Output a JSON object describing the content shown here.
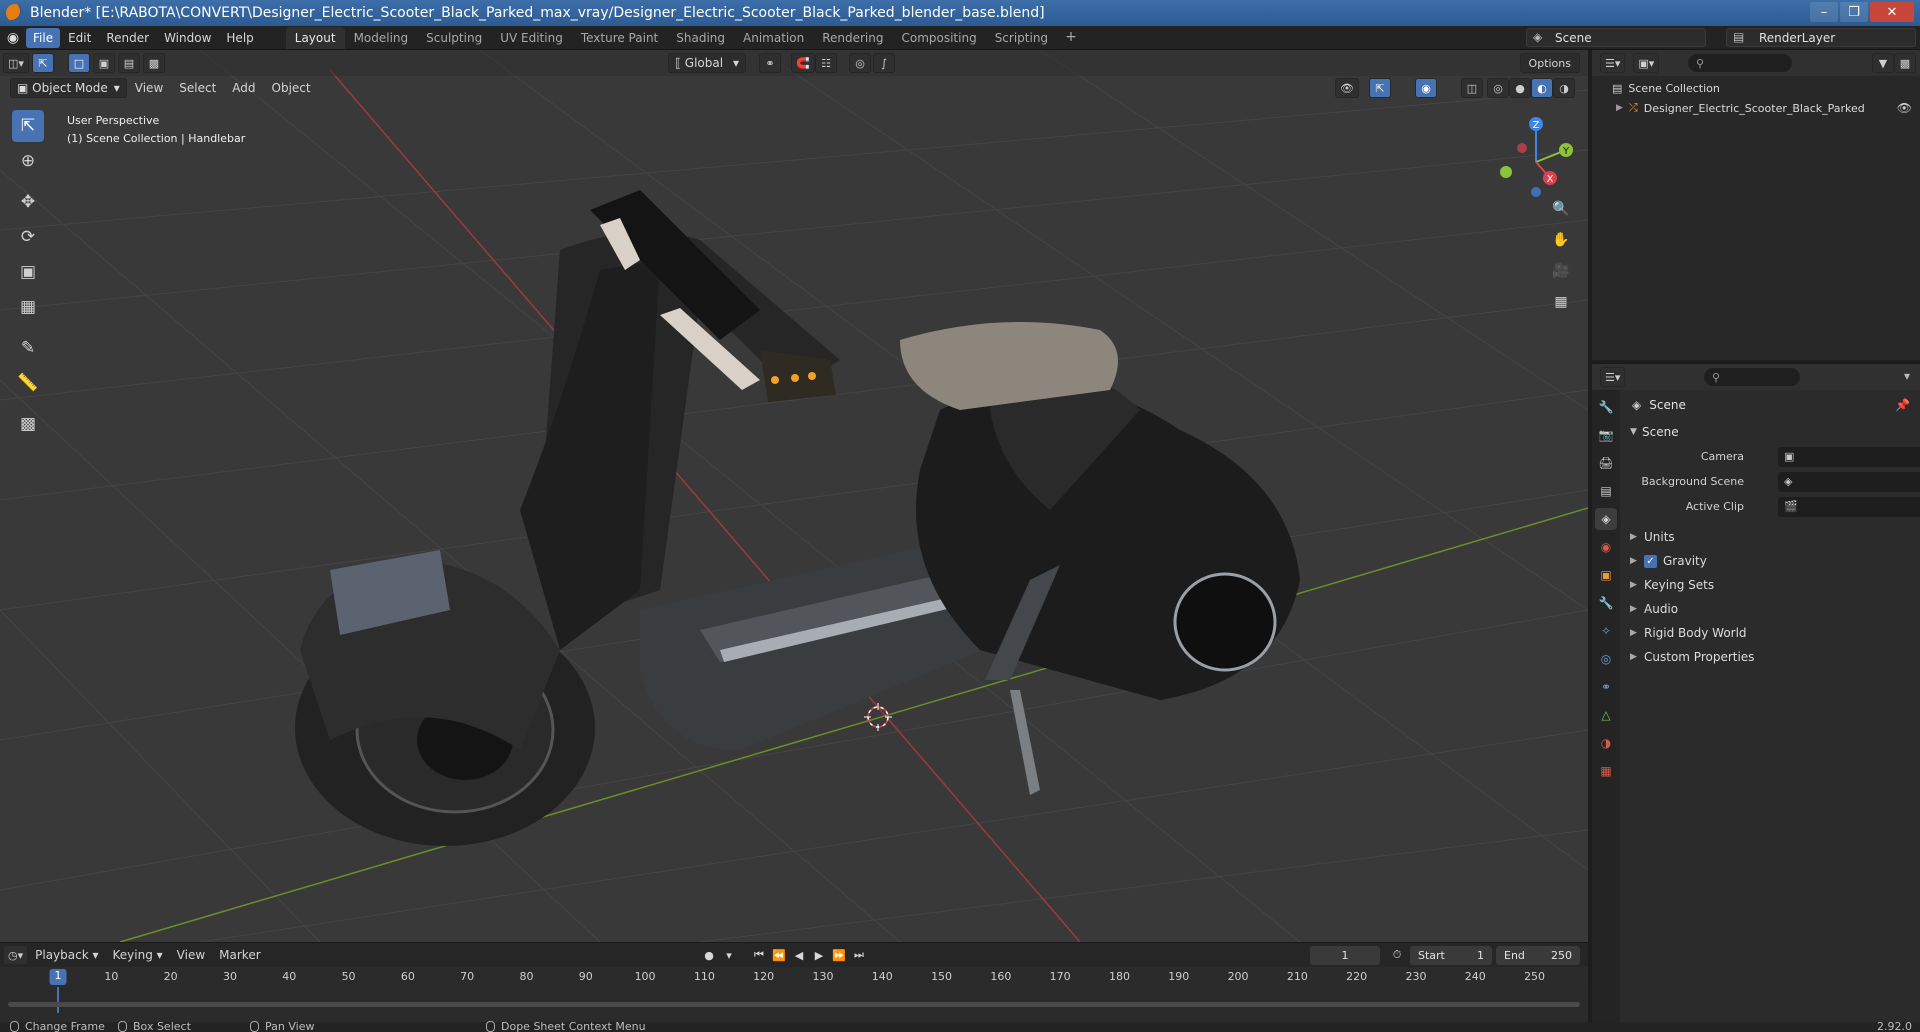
{
  "window": {
    "title": "Blender* [E:\\RABOTA\\CONVERT\\Designer_Electric_Scooter_Black_Parked_max_vray/Designer_Electric_Scooter_Black_Parked_blender_base.blend]",
    "min": "–",
    "max": "❐",
    "close": "✕"
  },
  "menus": [
    "File",
    "Edit",
    "Render",
    "Window",
    "Help"
  ],
  "workspaces": [
    "Layout",
    "Modeling",
    "Sculpting",
    "UV Editing",
    "Texture Paint",
    "Shading",
    "Animation",
    "Rendering",
    "Compositing",
    "Scripting"
  ],
  "workspace_add": "+",
  "scene_selector": "Scene",
  "view_layer_selector": "RenderLayer",
  "viewport": {
    "mode": "Object Mode",
    "menus": [
      "View",
      "Select",
      "Add",
      "Object"
    ],
    "orientation": "Global",
    "options": "Options",
    "info_line1": "User Perspective",
    "info_line2": "(1) Scene Collection | Handlebar",
    "gizmo": {
      "x": "X",
      "y": "Y",
      "z": "Z"
    }
  },
  "timeline": {
    "menus": [
      "Playback",
      "Keying",
      "View",
      "Marker"
    ],
    "current_frame": "1",
    "start_label": "Start",
    "start": "1",
    "end_label": "End",
    "end": "250",
    "ticks": [
      "10",
      "20",
      "30",
      "40",
      "50",
      "60",
      "70",
      "80",
      "90",
      "100",
      "110",
      "120",
      "130",
      "140",
      "150",
      "160",
      "170",
      "180",
      "190",
      "200",
      "210",
      "220",
      "230",
      "240",
      "250"
    ],
    "cursor_value": "1"
  },
  "statusbar": {
    "change_frame": "Change Frame",
    "box_select": "Box Select",
    "pan_view": "Pan View",
    "context_menu": "Dope Sheet Context Menu",
    "version": "2.92.0"
  },
  "outliner": {
    "root": "Scene Collection",
    "item": "Designer_Electric_Scooter_Black_Parked"
  },
  "properties": {
    "title": "Scene",
    "panel": "Scene",
    "fields": [
      {
        "label": "Camera",
        "value": ""
      },
      {
        "label": "Background Scene",
        "value": ""
      },
      {
        "label": "Active Clip",
        "value": ""
      }
    ],
    "subpanels": [
      "Units",
      "Gravity",
      "Keying Sets",
      "Audio",
      "Rigid Body World",
      "Custom Properties"
    ],
    "gravity_checked": true
  },
  "colors": {
    "accent": "#4772b3",
    "x_axis": "#d8434f",
    "y_axis": "#8bc33a",
    "z_axis": "#3f86e6"
  }
}
